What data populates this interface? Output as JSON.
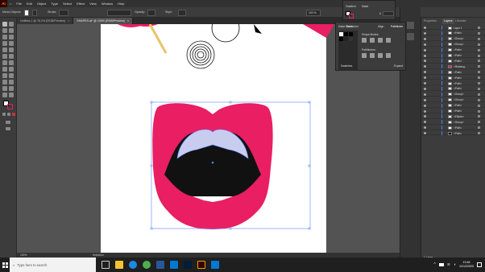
{
  "menubar": {
    "logo": "Ai",
    "items": [
      "File",
      "Edit",
      "Object",
      "Type",
      "Select",
      "Effect",
      "View",
      "Window",
      "Help"
    ]
  },
  "control": {
    "object_label": "Mixed Objects",
    "stroke_label": "Stroke:",
    "opacity_label": "Opacity:",
    "style_label": "Style:",
    "zoom_value": "100 %",
    "align_label": "Align",
    "essentials": "Essentials"
  },
  "tabs": [
    {
      "label": "Untitled-1 @ 76.2% (RGB/Preview)",
      "close": "×"
    },
    {
      "label": "SHAPES.ai* @ 100% (RGB/Preview)",
      "close": "×"
    }
  ],
  "color_panel": {
    "tab1": "Gradient",
    "tab2": "Color",
    "hex_prefix": "#"
  },
  "swatch_panel": {
    "tab_color_guide": "Color Guide",
    "tab_transform": "Transform",
    "tab_align": "Align",
    "tab_pathfinder": "Pathfinder",
    "shape_modes_label": "Shape Modes:",
    "pathfinders_label": "Pathfinders:",
    "expand_label": "Expand",
    "swatches_label": "Swatches"
  },
  "layers_panel": {
    "tab_properties": "Properties",
    "tab_layers": "Layers",
    "tab_libraries": "Libraries",
    "rows": [
      {
        "name": "Layer 1",
        "thumb": "#ffffff"
      },
      {
        "name": "<Path>",
        "thumb": "#ffffff"
      },
      {
        "name": "<Group>",
        "thumb": "#ffffff"
      },
      {
        "name": "<Group>",
        "thumb": "#ffffff"
      },
      {
        "name": "<Path>",
        "thumb": "#ffffff"
      },
      {
        "name": "<Path>",
        "thumb": "#ffffff"
      },
      {
        "name": "<Path>",
        "thumb": "#ffffff"
      },
      {
        "name": "<Rectang...",
        "thumb": "#e91e63"
      },
      {
        "name": "<Path>",
        "thumb": "#ffffff"
      },
      {
        "name": "<Path>",
        "thumb": "#ffffff"
      },
      {
        "name": "<Path>",
        "thumb": "#ffffff"
      },
      {
        "name": "<Path>",
        "thumb": "#ffffff"
      },
      {
        "name": "<Group>",
        "thumb": "#ffffff"
      },
      {
        "name": "<Group>",
        "thumb": "#ffffff"
      },
      {
        "name": "<Path>",
        "thumb": "#ffffff"
      },
      {
        "name": "<Path>",
        "thumb": "#ffffff"
      },
      {
        "name": "<Ellipse>",
        "thumb": "#ffffff"
      },
      {
        "name": "<Group>",
        "thumb": "#ffffff"
      },
      {
        "name": "<Path>",
        "thumb": "#ffffff"
      },
      {
        "name": "<Path>",
        "thumb": "#111111"
      }
    ],
    "footer": "1 Layer"
  },
  "status": {
    "zoom": "100%",
    "tool": "Selection"
  },
  "taskbar": {
    "search_placeholder": "Type here to search",
    "time": "13:46",
    "date": "12/12/2020"
  },
  "colors": {
    "lip_pink": "#e91e63",
    "mouth_dark": "#111111",
    "teeth_blue": "#c8cdf0",
    "selection_blue": "#5a82ff"
  }
}
